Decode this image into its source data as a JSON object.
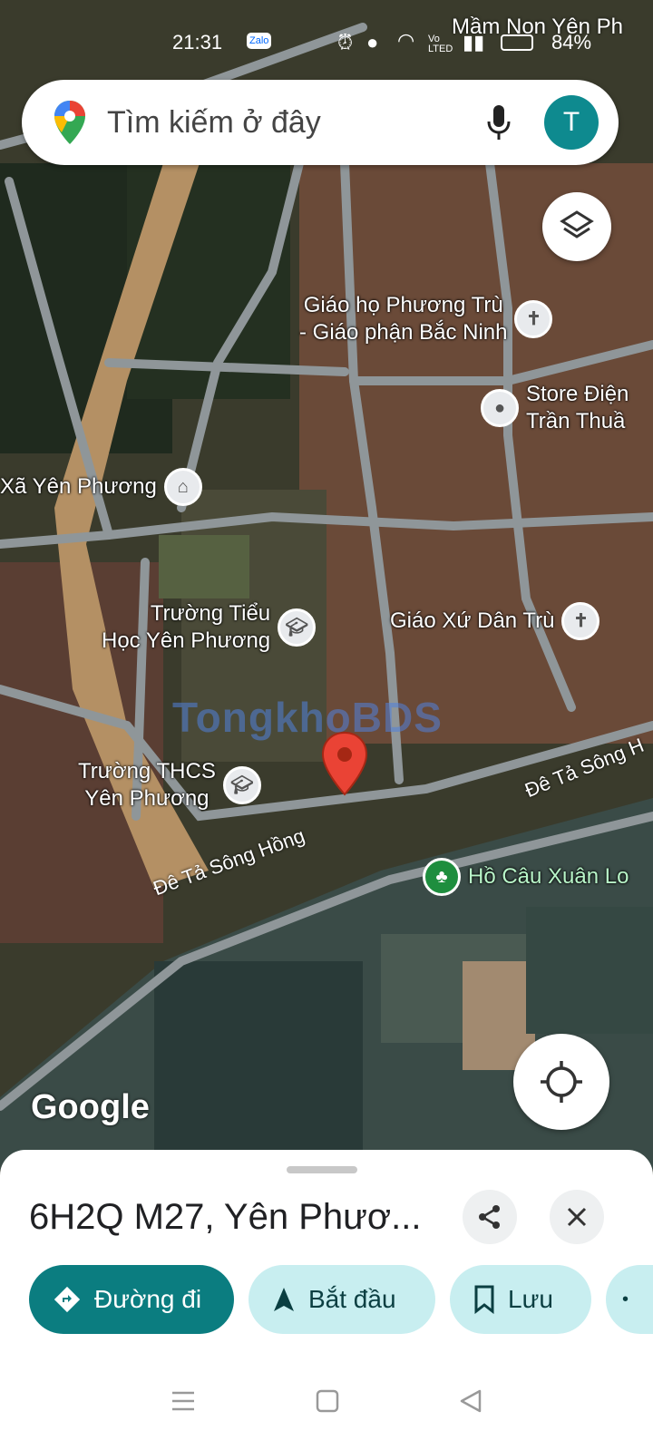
{
  "status_bar": {
    "time": "21:31",
    "notif_app": "Zalo",
    "network": "Vo LTED",
    "battery": "84%"
  },
  "search": {
    "placeholder": "Tìm kiếm ở đây",
    "avatar_letter": "T"
  },
  "map": {
    "top_label": "Mầm Non Yên Ph",
    "pois": [
      {
        "name": "Giáo họ Phương Trù\n- Giáo phận Bắc Ninh",
        "icon": "cross-icon"
      },
      {
        "name": "Store Điện\nTrần Thuầ",
        "icon": "pin-icon"
      },
      {
        "name": "Xã Yên Phương",
        "icon": "government-icon"
      },
      {
        "name": "Trường Tiểu\nHọc Yên Phương",
        "icon": "school-icon"
      },
      {
        "name": "Giáo Xứ Dân Trù",
        "icon": "cross-icon"
      },
      {
        "name": "Trường THCS\nYên Phương",
        "icon": "school-icon"
      },
      {
        "name": "Hồ Câu Xuân Lo",
        "icon": "park-icon"
      }
    ],
    "roads": [
      "Đê Tả Sông Hồng",
      "Đê Tả Sông H"
    ],
    "watermark": "TongkhoBDS",
    "attribution": "Google"
  },
  "sheet": {
    "title": "6H2Q M27, Yên Phươ...",
    "actions": {
      "directions": "Đường đi",
      "start": "Bắt đầu",
      "save": "Lưu"
    }
  },
  "colors": {
    "accent": "#0b7d80",
    "accent_light": "#c8eef0",
    "avatar": "#0e8a8f",
    "marker": "#ea4335"
  }
}
